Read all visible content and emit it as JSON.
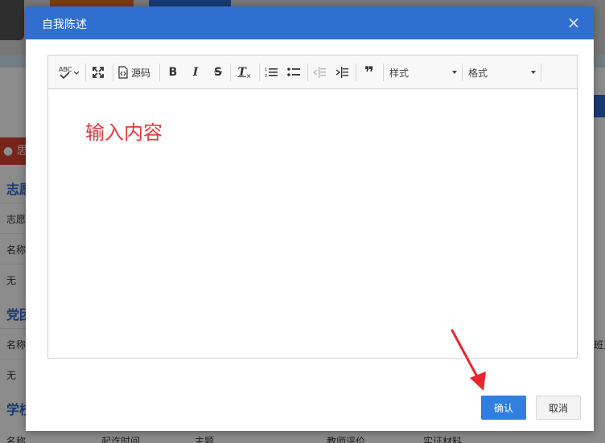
{
  "background": {
    "tab_label": "● 思",
    "rows": [
      "志愿",
      "志愿",
      "名称",
      "无",
      "党团",
      "名称",
      "无",
      "学校"
    ],
    "right_text": "班主",
    "footer_columns": [
      "名称",
      "起讫时间",
      "主题",
      "教师评价",
      "实证材料"
    ]
  },
  "dialog": {
    "title": "自我陈述",
    "close_label": "×"
  },
  "toolbar": {
    "spellcheck_label": "ABC",
    "source_label": "源码",
    "bold_label": "B",
    "italic_label": "I",
    "strike_label": "S",
    "clear_format_label": "T",
    "blockquote_label": "❞",
    "styles_label": "样式",
    "format_label": "格式"
  },
  "editor": {
    "placeholder": "输入内容"
  },
  "buttons": {
    "confirm_label": "确认",
    "cancel_label": "取消"
  },
  "colors": {
    "header": "#2f6fcf",
    "confirm": "#2f7ee0",
    "placeholder_text": "#e03b3b",
    "arrow": "#e8262f"
  }
}
